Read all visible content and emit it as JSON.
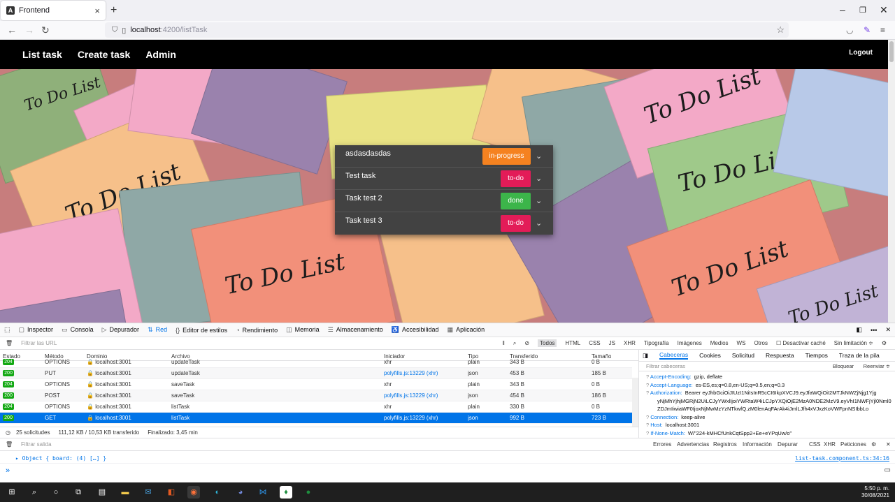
{
  "browser": {
    "tab_title": "Frontend",
    "tab_close": "×",
    "new_tab": "+",
    "url_host": "localhost",
    "url_path": ":4200/listTask"
  },
  "app": {
    "nav": [
      "List task",
      "Create task",
      "Admin"
    ],
    "logout": "Logout",
    "tasks": [
      {
        "name": "asdasdasdas",
        "status": "in-progress",
        "color": "#f58220"
      },
      {
        "name": "Test task",
        "status": "to-do",
        "color": "#e31c58"
      },
      {
        "name": "Task test 2",
        "status": "done",
        "color": "#3cb54a"
      },
      {
        "name": "Task test 3",
        "status": "to-do",
        "color": "#e31c58"
      }
    ],
    "background_text": "To Do List"
  },
  "devtools": {
    "tabs": [
      "Inspector",
      "Consola",
      "Depurador",
      "Red",
      "Editor de estilos",
      "Rendimiento",
      "Memoria",
      "Almacenamiento",
      "Accesibilidad",
      "Aplicación"
    ],
    "selected_tab": "Red",
    "filter_placeholder": "Filtrar las URL",
    "type_filters": [
      "Todos",
      "HTML",
      "CSS",
      "JS",
      "XHR",
      "Tipografía",
      "Imágenes",
      "Medios",
      "WS",
      "Otros"
    ],
    "disable_cache": "Desactivar caché",
    "throttle": "Sin limitación ≑",
    "columns": [
      "Estado",
      "Método",
      "Dominio",
      "Archivo",
      "Iniciador",
      "Tipo",
      "Transferido",
      "Tamaño"
    ],
    "rows": [
      {
        "status": "204",
        "method": "OPTIONS",
        "domain": "localhost:3001",
        "file": "updateTask",
        "initiator": "xhr",
        "type": "plain",
        "transferred": "343 B",
        "size": "0 B"
      },
      {
        "status": "200",
        "method": "PUT",
        "domain": "localhost:3001",
        "file": "updateTask",
        "initiator": "polyfills.js:13229 (xhr)",
        "type": "json",
        "transferred": "453 B",
        "size": "185 B"
      },
      {
        "status": "204",
        "method": "OPTIONS",
        "domain": "localhost:3001",
        "file": "saveTask",
        "initiator": "xhr",
        "type": "plain",
        "transferred": "343 B",
        "size": "0 B"
      },
      {
        "status": "200",
        "method": "POST",
        "domain": "localhost:3001",
        "file": "saveTask",
        "initiator": "polyfills.js:13229 (xhr)",
        "type": "json",
        "transferred": "454 B",
        "size": "186 B"
      },
      {
        "status": "204",
        "method": "OPTIONS",
        "domain": "localhost:3001",
        "file": "listTask",
        "initiator": "xhr",
        "type": "plain",
        "transferred": "330 B",
        "size": "0 B"
      },
      {
        "status": "200",
        "method": "GET",
        "domain": "localhost:3001",
        "file": "listTask",
        "initiator": "polyfills.js:13229 (xhr)",
        "type": "json",
        "transferred": "992 B",
        "size": "723 B"
      }
    ],
    "summary": {
      "requests": "25 solicitudes",
      "transfer": "111,12 KB / 10,53 KB transferido",
      "finished": "Finalizado: 3,45 min"
    },
    "header_tabs": [
      "Cabeceras",
      "Cookies",
      "Solicitud",
      "Respuesta",
      "Tiempos",
      "Traza de la pila"
    ],
    "header_filter": "Filtrar cabeceras",
    "block": "Bloquear",
    "resend": "Reenviar ≑",
    "headers": [
      {
        "k": "Accept-Encoding:",
        "v": "gzip, deflate"
      },
      {
        "k": "Accept-Language:",
        "v": "es-ES,es;q=0.8,en-US;q=0.5,en;q=0.3"
      },
      {
        "k": "Authorization:",
        "v": "Bearer eyJhbGciOiJIUzI1NiIsInR5cCI6IkpXVCJ9.eyJfaWQiOiI2MTJkNWZjNjg1Yjg"
      },
      {
        "k": "",
        "v": "yNjMhYjhjMGRjN2UiLCJyYWxlIjoiYWRtaW4iLCJpYXQiOjE2MzA0NDE2MzV9.eyVhI1NWFjYjl0Nml0"
      },
      {
        "k": "",
        "v": "ZDJmIiwiaWF0IjoxNjMwMzYzNTkwfQ.zM0lenAqFArAk4iJmlLJfh4xVJxzKoVWFpnNSIbbLo"
      },
      {
        "k": "Connection:",
        "v": "keep-alive"
      },
      {
        "k": "Host:",
        "v": "localhost:3001"
      },
      {
        "k": "If-None-Match:",
        "v": "W/\"224-kMHCfUnkCqtSpp2+Ee+eYPqUw/o\""
      }
    ],
    "console_filter": "Filtrar salida",
    "console_levels": [
      "Errores",
      "Advertencias",
      "Registros",
      "Información",
      "Depurar"
    ],
    "console_extra": [
      "CSS",
      "XHR",
      "Peticiones"
    ],
    "console_log": "▸ Object { board: (4) […] }",
    "console_source": "list-task.component.ts:34:16",
    "console_prompt": "»"
  },
  "taskbar": {
    "time": "5:50 p. m.",
    "date": "30/08/2021"
  }
}
